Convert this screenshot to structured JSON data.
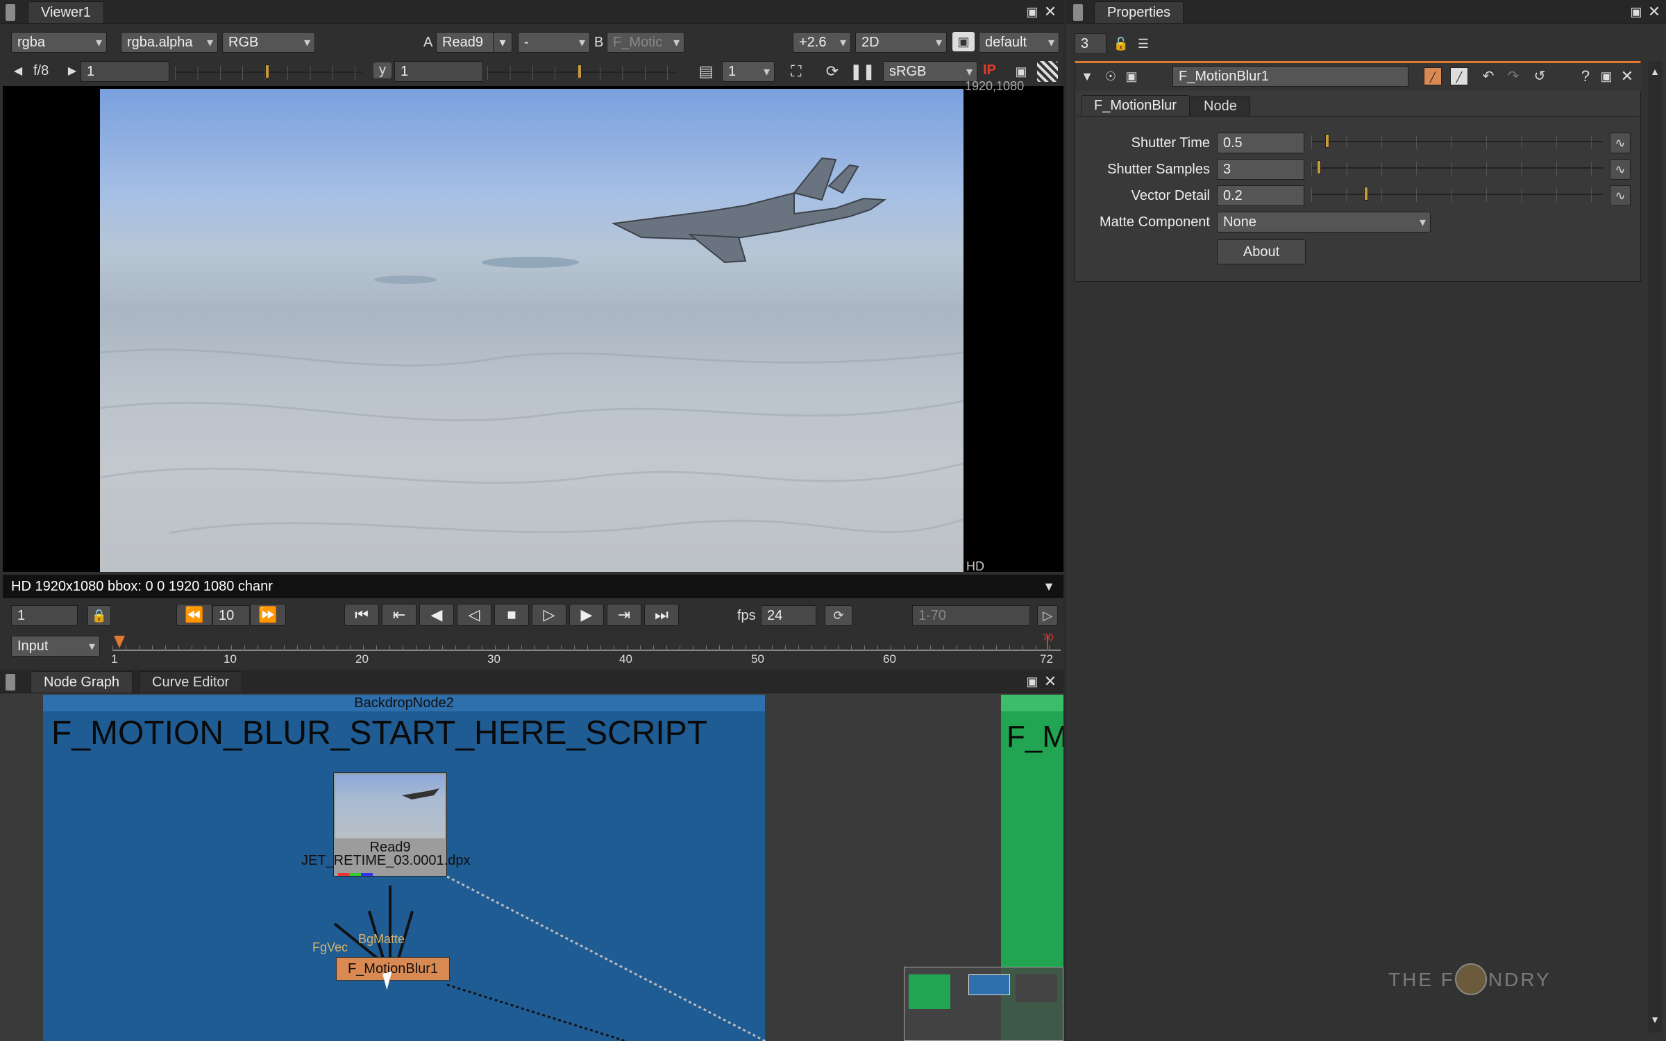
{
  "viewer": {
    "tab_label": "Viewer1",
    "channels": "rgba",
    "alpha_channel": "rgba.alpha",
    "display_mode": "RGB",
    "a_label": "A",
    "input_a": "Read9",
    "input_a_op": "-",
    "b_label": "B",
    "input_b": "F_Motic",
    "gain": "+2.6",
    "view_mode": "2D",
    "lut_profile": "default",
    "fstop": "f/8",
    "gain_value": "1",
    "gamma_label": "y",
    "gamma_value": "1",
    "downrez": "1",
    "colorspace": "sRGB",
    "ip_label": "IP",
    "corner_resolution": "1920,1080",
    "format_tag": "HD",
    "info_bar": "HD 1920x1080 bbox: 0 0 1920 1080 chanr"
  },
  "timeline": {
    "current_frame": "1",
    "step": "10",
    "fps_label": "fps",
    "fps": "24",
    "range": "1-70",
    "input_mode": "Input",
    "ticks": [
      "1",
      "10",
      "20",
      "30",
      "40",
      "50",
      "60",
      "72"
    ],
    "end_marker": "70"
  },
  "properties": {
    "tab_label": "Properties",
    "max_panels": "3",
    "node_name": "F_MotionBlur1",
    "tabs": [
      "F_MotionBlur",
      "Node"
    ],
    "params": [
      {
        "label": "Shutter Time",
        "value": "0.5",
        "fraction": 0.05,
        "ticks": [
          "0",
          "2",
          "4",
          "6",
          "8",
          "10"
        ]
      },
      {
        "label": "Shutter Samples",
        "value": "3",
        "fraction": 0.02,
        "ticks": [
          "1",
          "20",
          "40",
          "60",
          "80",
          "100"
        ]
      },
      {
        "label": "Vector Detail",
        "value": "0.2",
        "fraction": 0.19,
        "ticks": [
          "0.01",
          "0.2",
          "0.4",
          "0.6",
          "0.8",
          "1"
        ]
      }
    ],
    "matte_label": "Matte Component",
    "matte_value": "None",
    "about_label": "About"
  },
  "node_graph": {
    "tabs": [
      "Node Graph",
      "Curve Editor"
    ],
    "backdrop_name": "BackdropNode2",
    "backdrop_title": "F_MOTION_BLUR_START_HERE_SCRIPT",
    "backdrop2_title": "F_M",
    "read_node": "Read9",
    "read_file": "JET_RETIME_03.0001.dpx",
    "input_labels": "FgVec",
    "input_labels2": "BgMatte",
    "blur_node": "F_MotionBlur1",
    "watermark": "THE FOUNDRY"
  },
  "colors": {
    "backdrop_blue": "#1f5c94",
    "backdrop_green": "#22a552",
    "node_orange": "#d98a52",
    "accent_orange": "#e0782e"
  }
}
